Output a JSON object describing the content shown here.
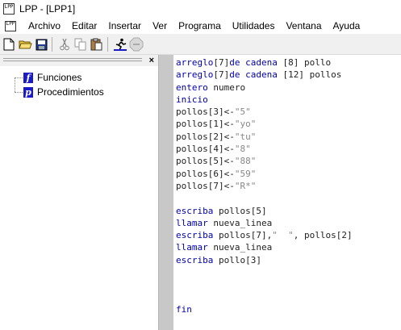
{
  "window": {
    "title": "LPP - [LPP1]",
    "icon_text": "LPP"
  },
  "menubar": {
    "doc_icon_text": "LPP",
    "items": [
      "Archivo",
      "Editar",
      "Insertar",
      "Ver",
      "Programa",
      "Utilidades",
      "Ventana",
      "Ayuda"
    ]
  },
  "toolbar": {
    "buttons": [
      "new-file-icon",
      "open-folder-icon",
      "save-icon",
      "cut-icon",
      "copy-icon",
      "paste-icon",
      "run-icon",
      "stop-icon"
    ]
  },
  "left_panel": {
    "close_glyph": "×",
    "tree": [
      {
        "icon_letter": "f",
        "label": "Funciones"
      },
      {
        "icon_letter": "p",
        "label": "Procedimientos"
      }
    ]
  },
  "editor": {
    "lines": [
      [
        [
          "kw",
          "arreglo"
        ],
        [
          "plain",
          "[7]"
        ],
        [
          "kw",
          "de cadena "
        ],
        [
          "plain",
          "[8] pollo"
        ]
      ],
      [
        [
          "kw",
          "arreglo"
        ],
        [
          "plain",
          "[7]"
        ],
        [
          "kw",
          "de cadena "
        ],
        [
          "plain",
          "[12] pollos"
        ]
      ],
      [
        [
          "kw",
          "entero"
        ],
        [
          "plain",
          " numero"
        ]
      ],
      [
        [
          "kw",
          "inicio"
        ]
      ],
      [
        [
          "plain",
          "pollos[3]<-"
        ],
        [
          "str",
          "\"5\""
        ]
      ],
      [
        [
          "plain",
          "pollos[1]<-"
        ],
        [
          "str",
          "\"yo\""
        ]
      ],
      [
        [
          "plain",
          "pollos[2]<-"
        ],
        [
          "str",
          "\"tu\""
        ]
      ],
      [
        [
          "plain",
          "pollos[4]<-"
        ],
        [
          "str",
          "\"8\""
        ]
      ],
      [
        [
          "plain",
          "pollos[5]<-"
        ],
        [
          "str",
          "\"88\""
        ]
      ],
      [
        [
          "plain",
          "pollos[6]<-"
        ],
        [
          "str",
          "\"59\""
        ]
      ],
      [
        [
          "plain",
          "pollos[7]<-"
        ],
        [
          "str",
          "\"R*\""
        ]
      ],
      [],
      [
        [
          "kw",
          "escriba"
        ],
        [
          "plain",
          " pollos[5]"
        ]
      ],
      [
        [
          "kw",
          "llamar"
        ],
        [
          "plain",
          " nueva_linea"
        ]
      ],
      [
        [
          "kw",
          "escriba"
        ],
        [
          "plain",
          " pollos[7],"
        ],
        [
          "str",
          "\"  \""
        ],
        [
          "plain",
          ", pollos[2]"
        ]
      ],
      [
        [
          "kw",
          "llamar"
        ],
        [
          "plain",
          " nueva_linea"
        ]
      ],
      [
        [
          "kw",
          "escriba"
        ],
        [
          "plain",
          " pollo[3]"
        ]
      ],
      [],
      [],
      [],
      [
        [
          "kw",
          "fin"
        ]
      ]
    ]
  }
}
